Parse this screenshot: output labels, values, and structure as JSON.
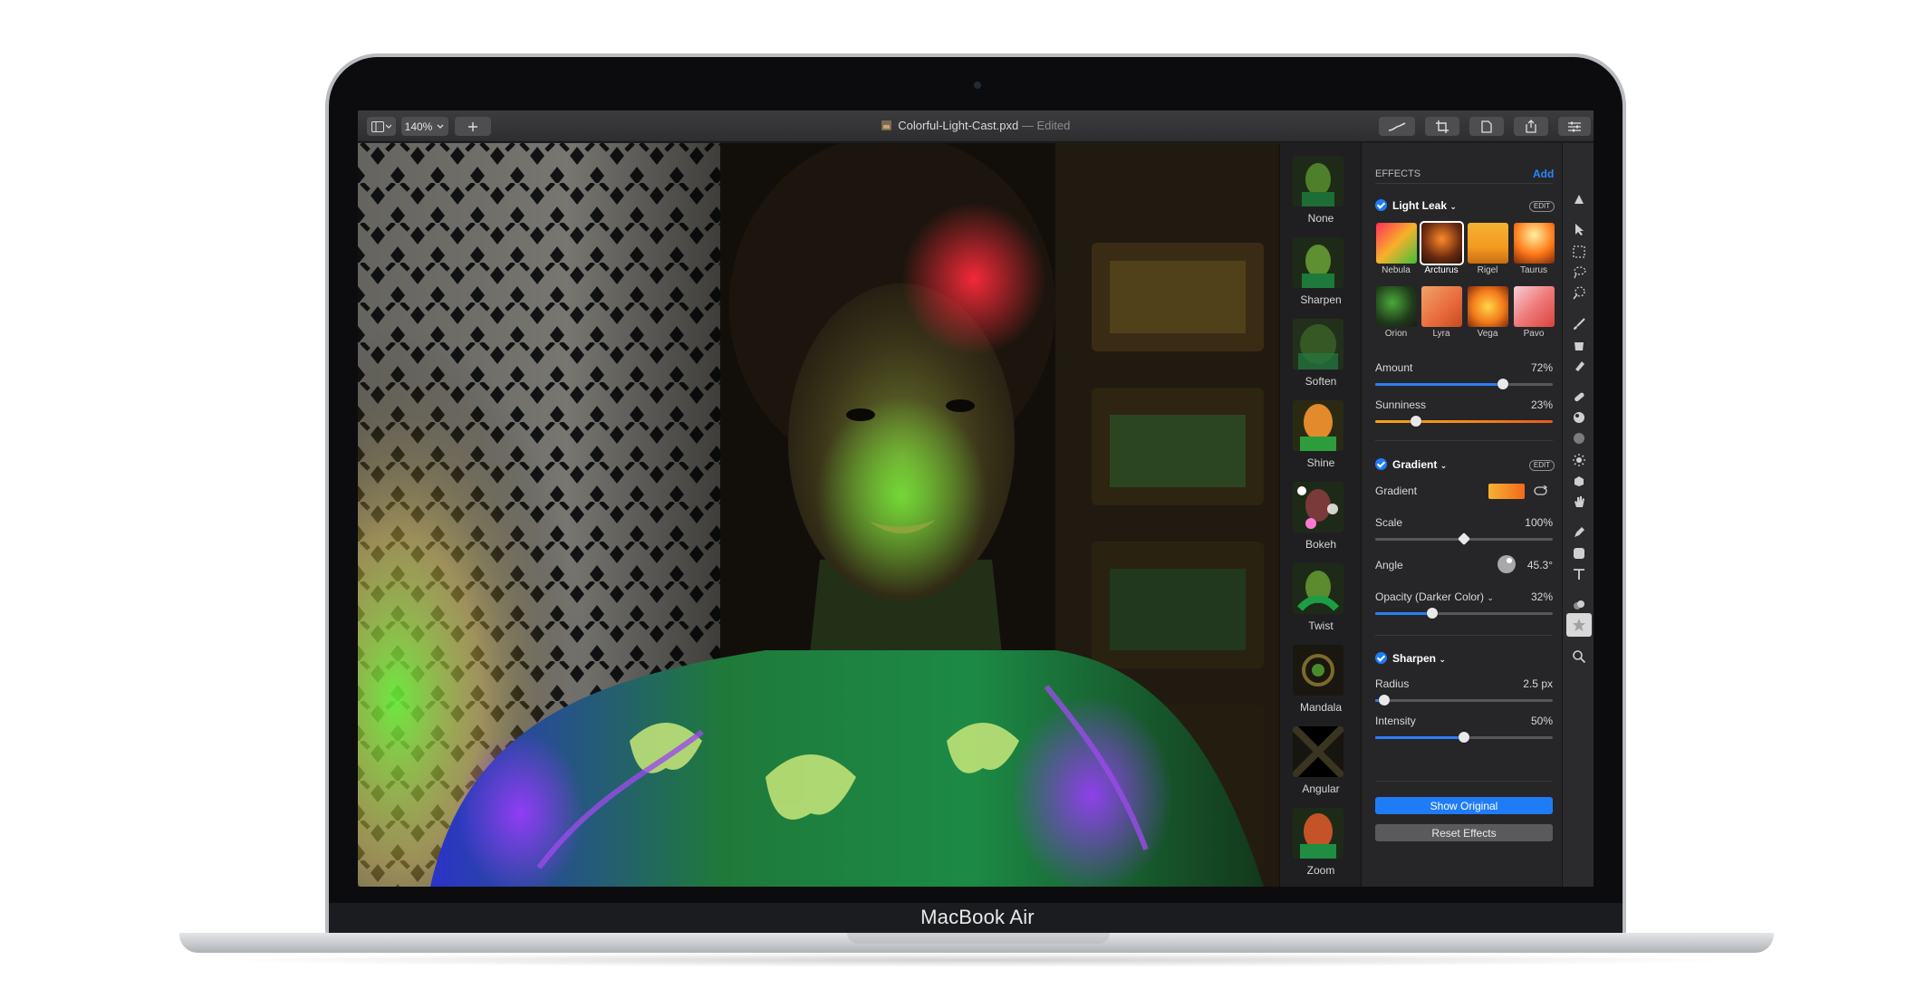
{
  "toolbar": {
    "zoom": "140%",
    "doc_name": "Colorful-Light-Cast.pxd",
    "doc_status": "— Edited"
  },
  "effects_browser": {
    "items": [
      "None",
      "Sharpen",
      "Soften",
      "Shine",
      "Bokeh",
      "Twist",
      "Mandala",
      "Angular",
      "Zoom"
    ]
  },
  "inspector": {
    "header": "EFFECTS",
    "add_label": "Add",
    "edit_label": "EDIT",
    "light_leak": {
      "title": "Light Leak",
      "presets": [
        "Nebula",
        "Arcturus",
        "Rigel",
        "Taurus",
        "Orion",
        "Lyra",
        "Vega",
        "Pavo"
      ],
      "selected_preset": "Arcturus",
      "amount_label": "Amount",
      "amount_value": "72%",
      "amount": 72,
      "sunniness_label": "Sunniness",
      "sunniness_value": "23%",
      "sunniness": 23
    },
    "gradient": {
      "title": "Gradient",
      "gradient_label": "Gradient",
      "scale_label": "Scale",
      "scale_value": "100%",
      "scale": 50,
      "angle_label": "Angle",
      "angle_value": "45.3°",
      "opacity_label": "Opacity (Darker Color)",
      "opacity_value": "32%",
      "opacity": 32
    },
    "sharpen": {
      "title": "Sharpen",
      "radius_label": "Radius",
      "radius_value": "2.5 px",
      "radius": 5,
      "intensity_label": "Intensity",
      "intensity_value": "50%",
      "intensity": 50
    },
    "show_original": "Show Original",
    "reset_effects": "Reset Effects"
  },
  "device": {
    "model": "MacBook Air"
  },
  "colors": {
    "accent": "#1f7cf6"
  }
}
